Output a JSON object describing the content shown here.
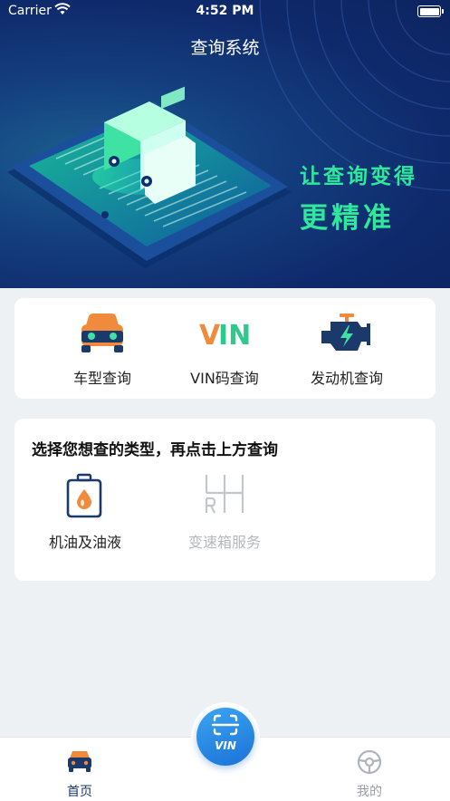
{
  "status_bar": {
    "carrier": "Carrier",
    "time": "4:52 PM"
  },
  "nav": {
    "title": "查询系统"
  },
  "banner": {
    "slogan_line1": "让查询变得",
    "slogan_line2": "更精准"
  },
  "query_options": [
    {
      "label": "车型查询",
      "icon": "car-front-icon"
    },
    {
      "label": "VIN码查询",
      "icon": "vin-text-icon",
      "icon_text_v": "V",
      "icon_text_in": "IN"
    },
    {
      "label": "发动机查询",
      "icon": "engine-icon"
    }
  ],
  "service_types": {
    "title": "选择您想查的类型，再点击上方查询",
    "items": [
      {
        "label": "机油及油液",
        "icon": "oil-can-icon",
        "enabled": true
      },
      {
        "label": "变速箱服务",
        "icon": "gear-shift-icon",
        "enabled": false
      }
    ]
  },
  "tabbar": {
    "home_label": "首页",
    "mine_label": "我的",
    "scan_label": "VIN"
  },
  "colors": {
    "accent_green": "#2ee89b",
    "primary_blue": "#1b72d8",
    "orange": "#f08a3c",
    "dark_navy": "#1b3a6b"
  }
}
